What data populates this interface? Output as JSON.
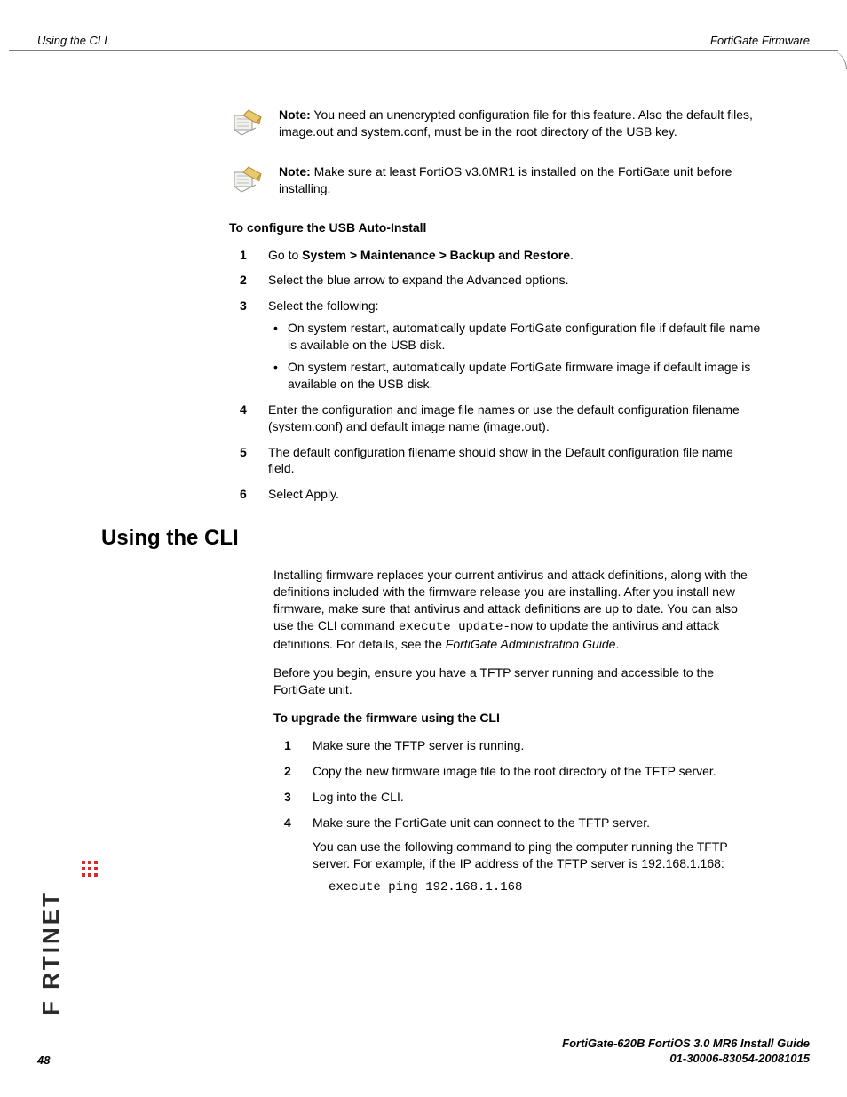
{
  "header": {
    "left": "Using the CLI",
    "right": "FortiGate Firmware"
  },
  "notes": {
    "n1": {
      "label": "Note:",
      "text": " You need an unencrypted configuration file for this feature. Also the default files, image.out and system.conf, must be in the root directory of the USB key."
    },
    "n2": {
      "label": "Note:",
      "text": " Make sure at least FortiOS v3.0MR1 is installed on the FortiGate unit before installing."
    }
  },
  "proc1": {
    "heading": "To configure the USB Auto-Install",
    "s1a": "Go to ",
    "s1b": "System > Maintenance > Backup and Restore",
    "s1c": ".",
    "s2": "Select the blue arrow to expand the Advanced options.",
    "s3": "Select the following:",
    "s3a": "On system restart, automatically update FortiGate configuration file if default file name is available on the USB disk.",
    "s3b": "On system restart, automatically update FortiGate firmware image if default image is available on the USB disk.",
    "s4": "Enter the configuration and image file names or use the default configuration filename (system.conf) and default image name (image.out).",
    "s5": "The default configuration filename should show in the Default configuration file name field.",
    "s6": "Select Apply."
  },
  "section2": {
    "heading": "Using the CLI",
    "p1a": "Installing firmware replaces your current antivirus and attack definitions, along with the definitions included with the firmware release you are installing. After you install new firmware, make sure that antivirus and attack definitions are up to date. You can also use the CLI command ",
    "p1code": "execute update-now",
    "p1b": " to update the antivirus and attack definitions. For details, see the ",
    "p1ital": "FortiGate Administration Guide",
    "p1c": ".",
    "p2": "Before you begin, ensure you have a TFTP server running and accessible to the FortiGate unit.",
    "proc_heading": "To upgrade the firmware using the CLI",
    "s1": "Make sure the TFTP server is running.",
    "s2": "Copy the new firmware image file to the root directory of the TFTP server.",
    "s3": "Log into the CLI.",
    "s4": "Make sure the FortiGate unit can connect to the TFTP server.",
    "s4para": "You can use the following command to ping the computer running the TFTP server. For example, if the IP address of the TFTP server is 192.168.1.168:",
    "s4code": "execute ping 192.168.1.168"
  },
  "brand": "F   RTINET",
  "footer": {
    "page": "48",
    "line1": "FortiGate-620B FortiOS 3.0 MR6 Install Guide",
    "line2": "01-30006-83054-20081015"
  }
}
